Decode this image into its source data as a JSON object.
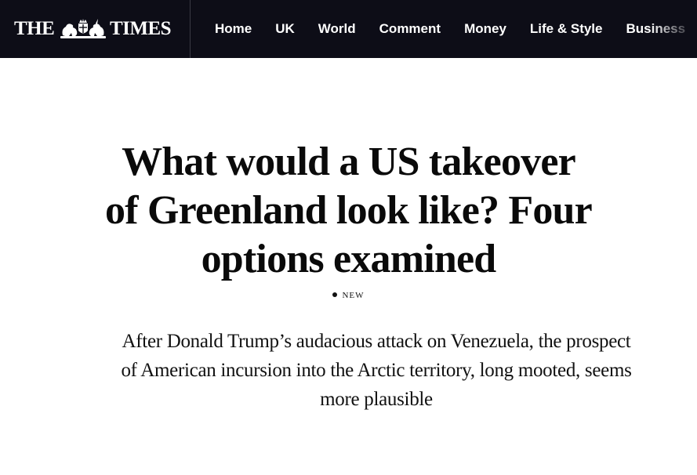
{
  "header": {
    "logo": {
      "the": "THE",
      "times": "TIMES",
      "crest_icon": "royal-crest-icon"
    },
    "nav": [
      "Home",
      "UK",
      "World",
      "Comment",
      "Money",
      "Life & Style",
      "Business"
    ]
  },
  "article": {
    "headline": "What would a US takeover of Greenland look like? Four options examined",
    "tag": "NEW",
    "standfirst": "After Donald Trump’s audacious attack on Venezuela, the prospect of American incursion into the Arctic territory, long mooted, seems more plausible"
  },
  "colors": {
    "header_bg": "#0d0d17",
    "header_text": "#ffffff",
    "body_text": "#0a0a0a",
    "page_bg": "#ffffff"
  }
}
